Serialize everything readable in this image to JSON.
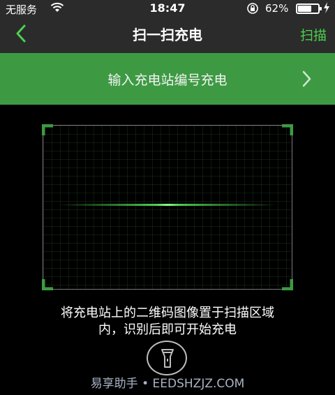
{
  "status_bar": {
    "carrier": "无服务",
    "time": "18:47",
    "battery_percent": "62%",
    "battery_level": 0.62
  },
  "nav": {
    "title": "扫一扫充电",
    "right_action": "扫描"
  },
  "banner": {
    "label": "输入充电站编号充电"
  },
  "hint": {
    "line1": "将充电站上的二维码图像置于扫描区域",
    "line2": "内，识别后即可开始充电"
  },
  "watermark": "易享助手 • EEDSHZJZ.COM",
  "colors": {
    "accent": "#4cd04f",
    "banner": "#3d9a43",
    "header": "#2b2b2b",
    "background": "#000000"
  },
  "icons": [
    "back-chevron-icon",
    "wifi-icon",
    "rotation-lock-icon",
    "battery-icon",
    "charging-bolt-icon",
    "forward-chevron-icon",
    "flashlight-icon"
  ]
}
